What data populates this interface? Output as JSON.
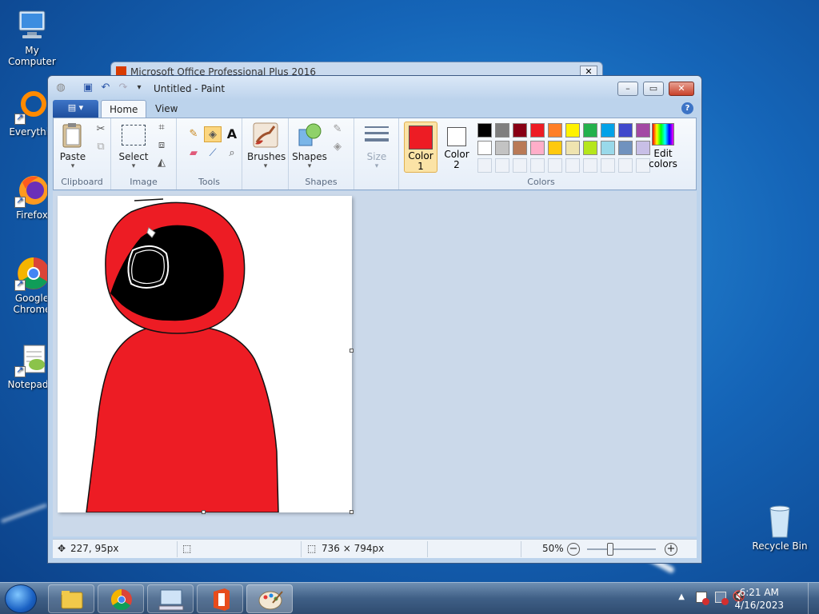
{
  "desktop": {
    "icons": [
      {
        "label": "My Computer"
      },
      {
        "label": "Everythin"
      },
      {
        "label": "Firefox"
      },
      {
        "label": "Google Chrome"
      },
      {
        "label": "Notepad+"
      },
      {
        "label": "Recycle Bin"
      }
    ]
  },
  "background_window": {
    "title": "Microsoft Office Professional Plus 2016",
    "close_label": "✕"
  },
  "paint": {
    "title": "Untitled - Paint",
    "file_label": "▤ ▾",
    "tabs": [
      {
        "label": "Home"
      },
      {
        "label": "View"
      }
    ],
    "help_label": "?",
    "groups": {
      "clipboard": {
        "label": "Clipboard",
        "paste": "Paste"
      },
      "image": {
        "label": "Image",
        "select": "Select"
      },
      "tools": {
        "label": "Tools"
      },
      "brushes": {
        "label": "Brushes"
      },
      "shapes": {
        "label": "Shapes",
        "shapes_btn": "Shapes"
      },
      "size": {
        "label": "Size"
      },
      "colors": {
        "label": "Colors",
        "color1": "Color 1",
        "color2": "Color 2",
        "edit": "Edit colors",
        "color1_value": "#ed1c24",
        "color2_value": "#ffffff",
        "row1": [
          "#000000",
          "#7f7f7f",
          "#880015",
          "#ed1c24",
          "#ff7f27",
          "#fff200",
          "#22b14c",
          "#00a2e8",
          "#3f48cc",
          "#a349a4"
        ],
        "row2": [
          "#ffffff",
          "#c3c3c3",
          "#b97a57",
          "#ffaec9",
          "#ffc90e",
          "#efe4b0",
          "#b5e61d",
          "#99d9ea",
          "#7092be",
          "#c8bfe7"
        ]
      }
    },
    "status": {
      "cursor": "227, 95px",
      "image_size": "736 × 794px",
      "zoom": "50%",
      "zoom_level": 0.5
    }
  },
  "taskbar": {
    "time": "6:21 AM",
    "date": "4/16/2023"
  }
}
